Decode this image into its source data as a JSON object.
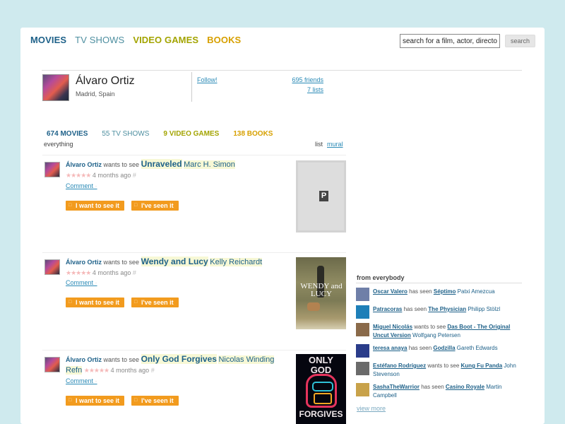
{
  "nav": {
    "movies": "MOVIES",
    "tv": "TV SHOWS",
    "games": "VIDEO GAMES",
    "books": "BOOKS"
  },
  "search": {
    "placeholder": "search for a film, actor, director...",
    "value": "search for a film, actor, director.",
    "button": "search"
  },
  "profile": {
    "name": "Álvaro Ortiz",
    "location": "Madrid, Spain",
    "follow": "Follow!",
    "friends": "695 friends",
    "lists": "7 lists"
  },
  "tabs": {
    "movies": "674 MOVIES",
    "tv": "55 TV SHOWS",
    "games": "9 VIDEO GAMES",
    "books": "138 BOOKS"
  },
  "filter": "everything",
  "viewmode": {
    "list": "list",
    "mural": "mural"
  },
  "feed": [
    {
      "user": "Álvaro Ortiz",
      "action": "wants to see",
      "title": "Unraveled",
      "director": "Marc H. Simon",
      "stars": "★★★★★",
      "ago": "4 months ago",
      "hash": "#",
      "comment": "Comment",
      "want": "I want to see it",
      "seen": "I've seen it",
      "poster_letter": "P"
    },
    {
      "user": "Álvaro Ortiz",
      "action": "wants to see",
      "title": "Wendy and Lucy",
      "director": "Kelly Reichardt",
      "stars": "★★★★★",
      "ago": "4 months ago",
      "hash": "#",
      "comment": "Comment",
      "want": "I want to see it",
      "seen": "I've seen it",
      "poster_text": "WENDY and LUCY"
    },
    {
      "user": "Álvaro Ortiz",
      "action": "wants to see",
      "title": "Only God Forgives",
      "director": "Nicolas Winding Refn",
      "stars": "★★★★★",
      "ago": "4 months ago",
      "hash": "#",
      "comment": "Comment",
      "want": "I want to see it",
      "seen": "I've seen it",
      "poster_top": "ONLY GOD",
      "poster_bottom": "FORGIVES"
    }
  ],
  "sidebar": {
    "heading": "from everybody",
    "items": [
      {
        "user": "Oscar Valero",
        "action": "has seen",
        "title": "Séptimo",
        "director": "Patxi Amezcua",
        "thumb_color": "#6f7fa8"
      },
      {
        "user": "Patracoras",
        "action": "has seen",
        "title": "The Physician",
        "director": "Philipp Stölzl",
        "thumb_color": "#1e7fb8"
      },
      {
        "user": "Miguel Nicolás",
        "action": "wants to see",
        "title": "Das Boot - The Original Uncut Version",
        "director": "Wolfgang Petersen",
        "thumb_color": "#8a6a4a"
      },
      {
        "user": "teresa anaya",
        "action": "has seen",
        "title": "Godzilla",
        "director": "Gareth Edwards",
        "thumb_color": "#2a3c8a"
      },
      {
        "user": "Estéfano Rodríguez",
        "action": "wants to see",
        "title": "Kung Fu Panda",
        "director": "John Stevenson",
        "thumb_color": "#6a6a6a"
      },
      {
        "user": "SashaTheWarrior",
        "action": "has seen",
        "title": "Casino Royale",
        "director": "Martin Campbell",
        "thumb_color": "#c8a24a"
      }
    ],
    "view_more": "view more"
  }
}
